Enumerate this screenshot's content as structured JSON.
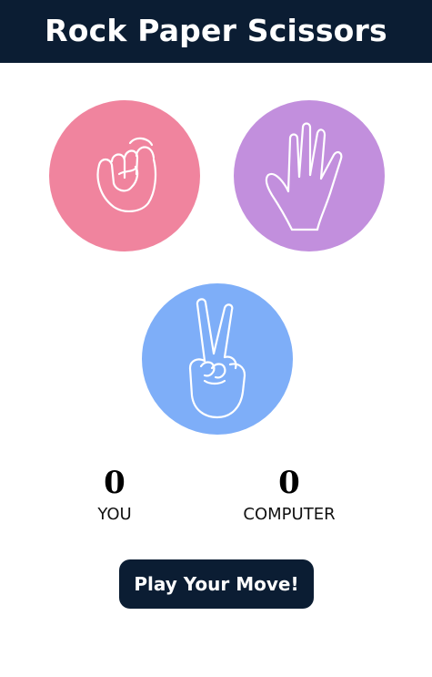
{
  "header": {
    "title": "Rock Paper Scissors",
    "background": "#0b1d33"
  },
  "choices": [
    {
      "name": "rock",
      "icon": "fist-icon",
      "color": "#f0849e"
    },
    {
      "name": "paper",
      "icon": "open-hand-icon",
      "color": "#c28fdd"
    },
    {
      "name": "scissors",
      "icon": "peace-sign-icon",
      "color": "#7eaef8"
    }
  ],
  "scores": {
    "you": {
      "value": "0",
      "label": "YOU"
    },
    "computer": {
      "value": "0",
      "label": "COMPUTER"
    }
  },
  "play_button": {
    "label": "Play Your Move!",
    "color": "#0b1d33"
  }
}
